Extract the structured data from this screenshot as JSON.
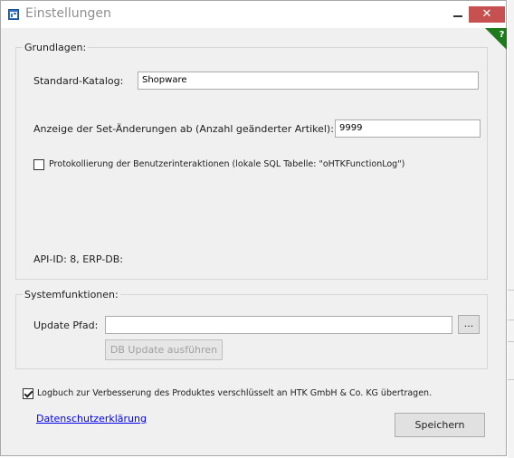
{
  "window": {
    "title": "Einstellungen",
    "close_glyph": "✕",
    "help_glyph": "?"
  },
  "grundlagen": {
    "legend": "Grundlagen:",
    "standard_katalog_label": "Standard-Katalog:",
    "standard_katalog_value": "Shopware",
    "set_aenderungen_label": "Anzeige der Set-Änderungen ab (Anzahl geänderter Artikel):",
    "set_aenderungen_value": "9999",
    "protokoll_label": "Protokollierung der Benutzerinteraktionen (lokale SQL Tabelle:  \"oHTKFunctionLog\")",
    "protokoll_checked": false,
    "api_info": "API-ID: 8, ERP-DB:"
  },
  "systemfunktionen": {
    "legend": "Systemfunktionen:",
    "update_pfad_label": "Update Pfad:",
    "update_pfad_value": "",
    "browse_label": "...",
    "db_update_label": "DB Update ausführen"
  },
  "footer": {
    "logbuch_label": "Logbuch zur Verbesserung des Produktes verschlüsselt an HTK GmbH & Co. KG übertragen.",
    "logbuch_checked": true,
    "datenschutz_label": "Datenschutzerklärung",
    "save_label": "Speichern"
  },
  "colors": {
    "close": "#c75050",
    "help_corner": "#1d7a1d",
    "link": "#0000ee"
  }
}
